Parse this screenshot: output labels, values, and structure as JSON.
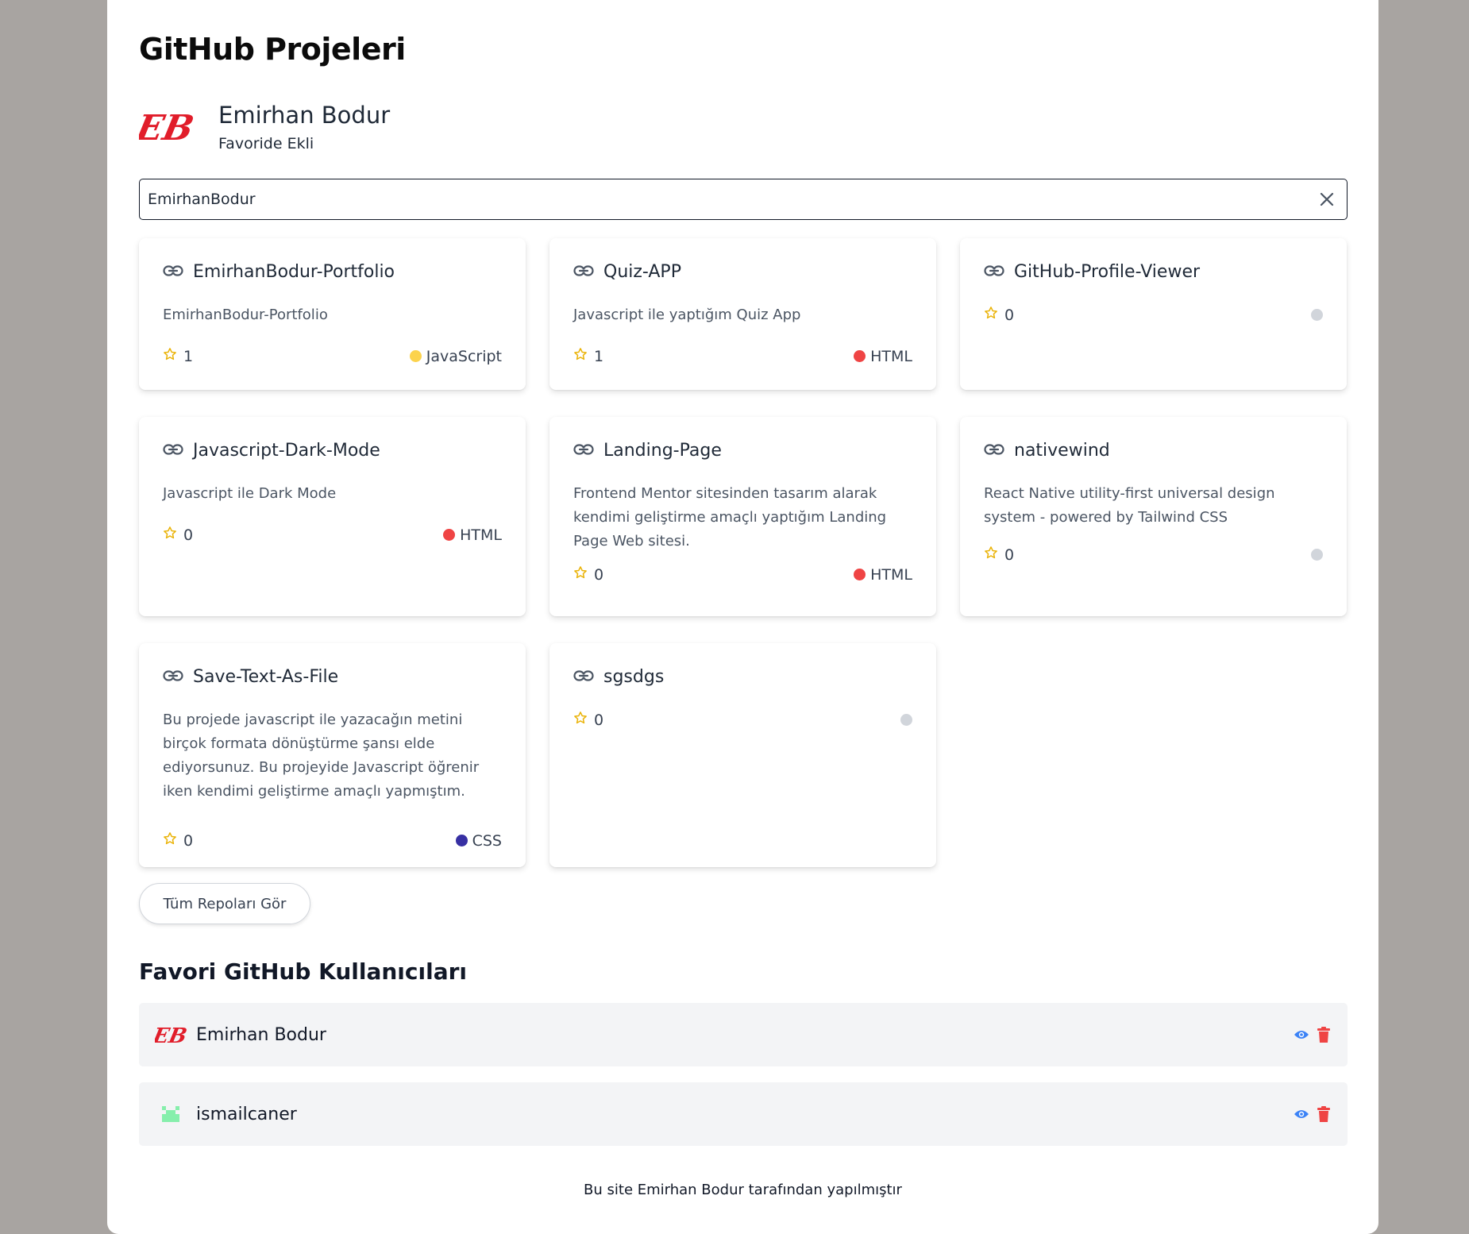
{
  "page": {
    "title": "GitHub Projeleri"
  },
  "profile": {
    "logo_text": "EB",
    "name": "Emirhan Bodur",
    "status": "Favoride Ekli"
  },
  "search": {
    "value": "EmirhanBodur",
    "clear_icon": "close-icon"
  },
  "repos": [
    {
      "name": "EmirhanBodur-Portfolio",
      "description": "EmirhanBodur-Portfolio",
      "stars": "1",
      "language": "JavaScript",
      "color": "#fcd34d"
    },
    {
      "name": "Quiz-APP",
      "description": "Javascript ile yaptığım Quiz App",
      "stars": "1",
      "language": "HTML",
      "color": "#ef4444"
    },
    {
      "name": "GitHub-Profile-Viewer",
      "description": "",
      "stars": "0",
      "language": "",
      "color": "#d1d5db"
    },
    {
      "name": "Javascript-Dark-Mode",
      "description": "Javascript ile Dark Mode",
      "stars": "0",
      "language": "HTML",
      "color": "#ef4444"
    },
    {
      "name": "Landing-Page",
      "description": "Frontend Mentor sitesinden tasarım alarak kendimi geliştirme amaçlı yaptığım Landing Page Web sitesi.",
      "stars": "0",
      "language": "HTML",
      "color": "#ef4444"
    },
    {
      "name": "nativewind",
      "description": "React Native utility-first universal design system - powered by Tailwind CSS",
      "stars": "0",
      "language": "",
      "color": "#d1d5db"
    },
    {
      "name": "Save-Text-As-File",
      "description": "Bu projede javascript ile yazacağın metini birçok formata dönüştürme şansı elde ediyorsunuz. Bu projeyide Javascript öğrenir iken kendimi geliştirme amaçlı yapmıştım.",
      "stars": "0",
      "language": "CSS",
      "color": "#3730a3"
    },
    {
      "name": "sgsdgs",
      "description": "",
      "stars": "0",
      "language": "",
      "color": "#d1d5db"
    }
  ],
  "all_repos_button": "Tüm Repoları Gör",
  "favorites": {
    "title": "Favori GitHub Kullanıcıları",
    "users": [
      {
        "name": "Emirhan Bodur",
        "avatar_text": "EB",
        "view_icon": "eye-icon",
        "delete_icon": "trash-icon"
      },
      {
        "name": "ismailcaner",
        "avatar_text": "",
        "view_icon": "eye-icon",
        "delete_icon": "trash-icon"
      }
    ]
  },
  "footer": "Bu site Emirhan Bodur tarafından yapılmıştır",
  "colors": {
    "star": "#eab308",
    "view": "#3b82f6",
    "delete": "#ef4444",
    "logo": "#e11d2a"
  }
}
